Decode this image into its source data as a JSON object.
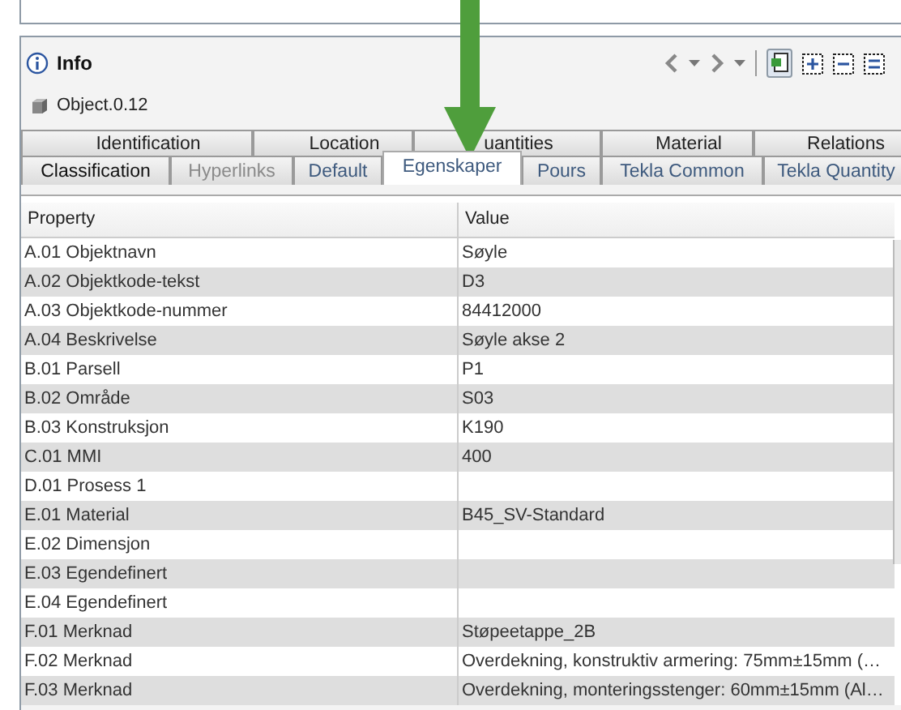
{
  "panel": {
    "title": "Info",
    "object": "Object.0.12"
  },
  "toolbar": {
    "pinned": true
  },
  "tabs": {
    "row_1": [
      {
        "label": "Identification",
        "selected": false
      },
      {
        "label": "Location",
        "selected": false
      },
      {
        "label": "uantities",
        "selected": false
      },
      {
        "label": "Material",
        "selected": false
      },
      {
        "label": "Relations",
        "selected": false
      }
    ],
    "row_2": [
      {
        "label": "Classification",
        "selected": false,
        "disabled": false
      },
      {
        "label": "Hyperlinks",
        "selected": false,
        "disabled": true
      },
      {
        "label": "Default",
        "selected": false,
        "disabled": false
      },
      {
        "label": "Egenskaper",
        "selected": true,
        "disabled": false
      },
      {
        "label": "Pours",
        "selected": false,
        "disabled": false
      },
      {
        "label": "Tekla Common",
        "selected": false,
        "disabled": false
      },
      {
        "label": "Tekla Quantity",
        "selected": false,
        "disabled": false
      }
    ]
  },
  "table": {
    "columns": [
      "Property",
      "Value"
    ],
    "rows": [
      [
        "A.01 Objektnavn",
        "Søyle"
      ],
      [
        "A.02 Objektkode-tekst",
        "D3"
      ],
      [
        "A.03 Objektkode-nummer",
        "84412000"
      ],
      [
        "A.04 Beskrivelse",
        "Søyle akse 2"
      ],
      [
        "B.01 Parsell",
        "P1"
      ],
      [
        "B.02 Område",
        "S03"
      ],
      [
        "B.03 Konstruksjon",
        "K190"
      ],
      [
        "C.01 MMI",
        "400"
      ],
      [
        "D.01 Prosess 1",
        ""
      ],
      [
        "E.01 Material",
        "B45_SV-Standard"
      ],
      [
        "E.02 Dimensjon",
        ""
      ],
      [
        "E.03 Egendefinert",
        ""
      ],
      [
        "E.04 Egendefinert",
        ""
      ],
      [
        "F.01 Merknad",
        "Støpeetappe_2B"
      ],
      [
        "F.02 Merknad",
        "Overdekning, konstruktiv armering: 75mm±15mm (…"
      ],
      [
        "F.03 Merknad",
        "Overdekning, monteringsstenger: 60mm±15mm (Al…"
      ]
    ]
  }
}
